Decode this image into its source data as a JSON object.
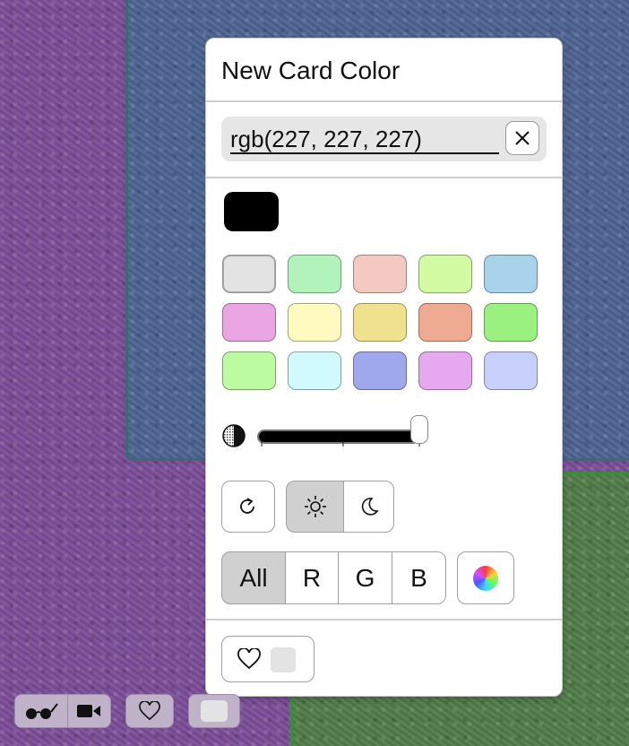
{
  "panel": {
    "title": "New Card Color",
    "color_value": "rgb(227, 227, 227)",
    "clear_icon": "close-icon",
    "preview_color": "#000000",
    "swatches": [
      "#e3e3e3",
      "#b2f2bb",
      "#f4c9c2",
      "#d2fba4",
      "#a8d3ea",
      "#eaa6e2",
      "#fffbc0",
      "#efe28e",
      "#efab91",
      "#9bf180",
      "#bdfba0",
      "#d0fafd",
      "#a0a8ed",
      "#e6a8ef",
      "#c7d0fb"
    ],
    "selected_swatch_index": 0,
    "lightness_slider_value": 1.0,
    "reset_icon": "rotate-icon",
    "theme_options": [
      {
        "name": "light",
        "icon": "sun-icon",
        "active": true
      },
      {
        "name": "dark",
        "icon": "moon-icon",
        "active": false
      }
    ],
    "channels": [
      {
        "label": "All",
        "active": true
      },
      {
        "label": "R",
        "active": false
      },
      {
        "label": "G",
        "active": false
      },
      {
        "label": "B",
        "active": false
      }
    ],
    "color_wheel_icon": "color-wheel-icon",
    "favorites_icon": "heart-icon",
    "favorite_slot_color": "#e3e3e3"
  },
  "toolbar": {
    "view_icon": "glasses-icon",
    "video_icon": "video-camera-icon",
    "heart_icon": "heart-icon",
    "color_slot": "#e3e3e3"
  },
  "colors": {
    "background_purple": "#7a4d97",
    "card_blue": "#4d6390",
    "card_green": "#507c48",
    "active_button": "#d0d0d0"
  }
}
